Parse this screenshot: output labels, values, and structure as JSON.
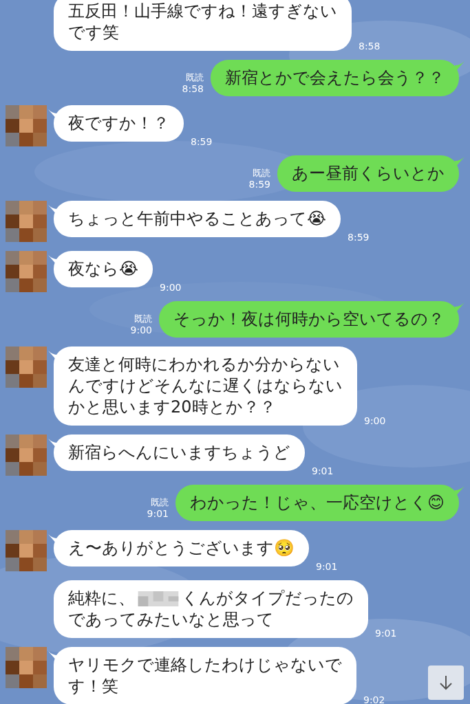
{
  "messages": [
    {
      "kind": "incoming",
      "avatar": false,
      "lines": [
        [
          {
            "kind": "text",
            "text": "五反田！山手線ですね！遠すぎない"
          }
        ],
        [
          {
            "kind": "text",
            "text": "です笑"
          }
        ]
      ],
      "time": "8:58"
    },
    {
      "kind": "outgoing",
      "read_label": "既読",
      "lines": [
        [
          {
            "kind": "text",
            "text": "新宿とかで会えたら会う？？"
          }
        ]
      ],
      "time": "8:58"
    },
    {
      "kind": "incoming",
      "avatar": true,
      "lines": [
        [
          {
            "kind": "text",
            "text": "夜ですか！？"
          }
        ]
      ],
      "time": "8:59"
    },
    {
      "kind": "outgoing",
      "read_label": "既読",
      "lines": [
        [
          {
            "kind": "text",
            "text": "あー昼前くらいとか"
          }
        ]
      ],
      "time": "8:59"
    },
    {
      "kind": "incoming",
      "avatar": true,
      "lines": [
        [
          {
            "kind": "text",
            "text": "ちょっと午前中やることあって😭"
          }
        ]
      ],
      "time": "8:59"
    },
    {
      "kind": "incoming",
      "avatar": true,
      "lines": [
        [
          {
            "kind": "text",
            "text": "夜なら😭"
          }
        ]
      ],
      "time": "9:00"
    },
    {
      "kind": "outgoing",
      "read_label": "既読",
      "lines": [
        [
          {
            "kind": "text",
            "text": "そっか！夜は何時から空いてるの？"
          }
        ]
      ],
      "time": "9:00"
    },
    {
      "kind": "incoming",
      "avatar": true,
      "lines": [
        [
          {
            "kind": "text",
            "text": "友達と何時にわかれるか分からない"
          }
        ],
        [
          {
            "kind": "text",
            "text": "んですけどそんなに遅くはならない"
          }
        ],
        [
          {
            "kind": "text",
            "text": "かと思います20時とか？？"
          }
        ]
      ],
      "time": "9:00"
    },
    {
      "kind": "incoming",
      "avatar": true,
      "lines": [
        [
          {
            "kind": "text",
            "text": "新宿らへんにいますちょうど"
          }
        ]
      ],
      "time": "9:01"
    },
    {
      "kind": "outgoing",
      "read_label": "既読",
      "lines": [
        [
          {
            "kind": "text",
            "text": "わかった！じゃ、一応空けとく😊"
          }
        ]
      ],
      "time": "9:01"
    },
    {
      "kind": "incoming",
      "avatar": true,
      "lines": [
        [
          {
            "kind": "text",
            "text": "え〜ありがとうございます🥺"
          }
        ]
      ],
      "time": "9:01"
    },
    {
      "kind": "incoming",
      "avatar": false,
      "lines": [
        [
          {
            "kind": "text",
            "text": "純粋に、"
          },
          {
            "kind": "redacted"
          },
          {
            "kind": "text",
            "text": "くんがタイプだったの"
          }
        ],
        [
          {
            "kind": "text",
            "text": "であってみたいなと思って"
          }
        ]
      ],
      "time": "9:01"
    },
    {
      "kind": "incoming",
      "avatar": true,
      "lines": [
        [
          {
            "kind": "text",
            "text": "ヤリモクで連絡したわけじゃないで"
          }
        ],
        [
          {
            "kind": "text",
            "text": "す！笑"
          }
        ]
      ],
      "time": "9:02"
    }
  ]
}
